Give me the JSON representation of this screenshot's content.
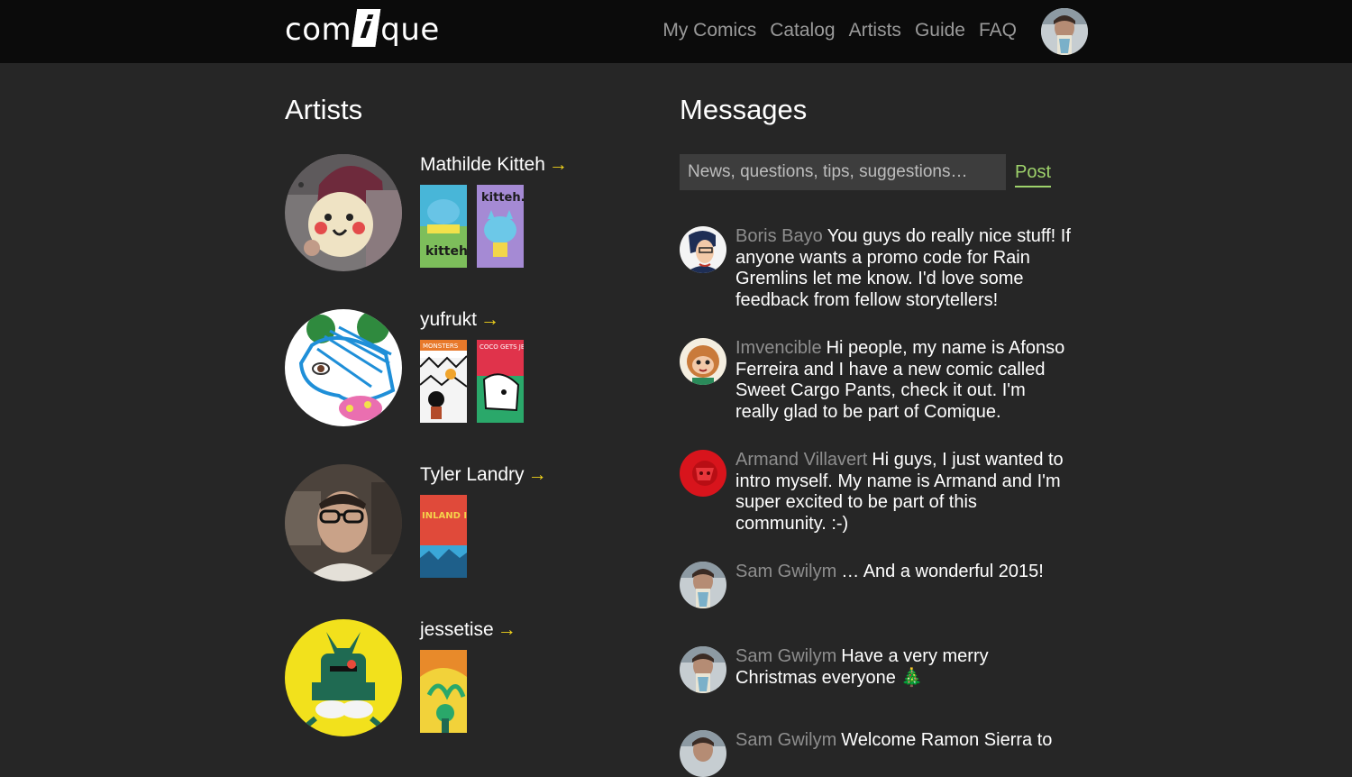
{
  "header": {
    "logo": {
      "pre": "com",
      "boxed": "i",
      "post": "que"
    },
    "nav": [
      "My Comics",
      "Catalog",
      "Artists",
      "Guide",
      "FAQ"
    ]
  },
  "artists": {
    "title": "Artists",
    "arrow": "→",
    "items": [
      {
        "name": "Mathilde Kitteh",
        "covers": [
          "kitteh-cover-1",
          "kitteh-cover-2"
        ]
      },
      {
        "name": "yufrukt",
        "covers": [
          "monsters-cover",
          "coco-gets-jealous-cover"
        ]
      },
      {
        "name": "Tyler Landry",
        "covers": [
          "inland-island-cover"
        ]
      },
      {
        "name": "jessetise",
        "covers": [
          "jessetise-cover"
        ]
      }
    ],
    "cover_text": {
      "kitteh1": "kitteh.",
      "kitteh2": "kitteh.",
      "monsters": "MONSTERS",
      "coco": "COCO GETS JEALOUS",
      "inland": "INLAND ISLAND"
    }
  },
  "messages": {
    "title": "Messages",
    "input_placeholder": "News, questions, tips, suggestions…",
    "post_label": "Post",
    "items": [
      {
        "author": "Boris Bayo",
        "text": "You guys do really nice stuff! If anyone wants a promo code for Rain Gremlins let me know. I'd love some feedback from fellow storytellers!"
      },
      {
        "author": "Imvencible",
        "text": "Hi people, my name is Afonso Ferreira and I have a new comic called Sweet Cargo Pants, check it out. I'm really glad to be part of Comique."
      },
      {
        "author": "Armand Villavert",
        "text": "Hi guys, I just wanted to intro myself. My name is Armand and I'm super excited to be part of this community. :-)"
      },
      {
        "author": "Sam Gwilym",
        "text": "… And a wonderful 2015!"
      },
      {
        "author": "Sam Gwilym",
        "text": "Have a very merry Christmas everyone 🎄"
      },
      {
        "author": "Sam Gwilym",
        "text": "Welcome Ramon Sierra to"
      }
    ]
  },
  "colors": {
    "accent_arrow": "#f0d21b",
    "post": "#9ed26b",
    "author": "#8e8e8e"
  }
}
